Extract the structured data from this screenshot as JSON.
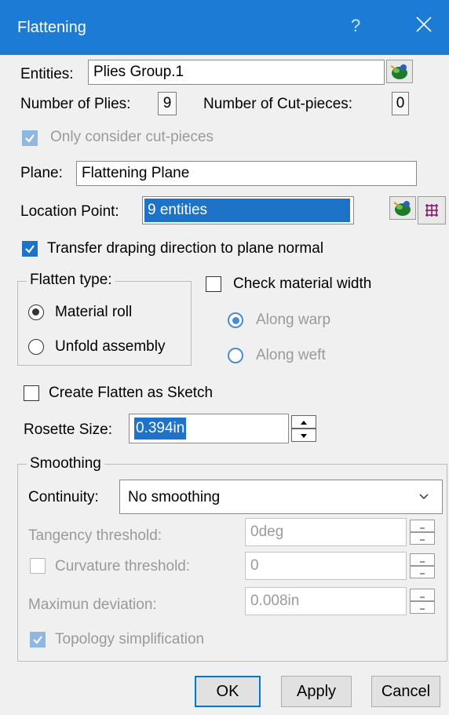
{
  "dialog": {
    "title": "Flattening",
    "help_glyph": "?"
  },
  "entities": {
    "label": "Entities:",
    "value": "Plies Group.1"
  },
  "counts": {
    "plies_label": "Number of Plies:",
    "plies_value": "9",
    "cut_label": "Number of Cut-pieces:",
    "cut_value": "0"
  },
  "only_cut": {
    "label": "Only consider cut-pieces",
    "checked": true,
    "enabled": false
  },
  "plane": {
    "label": "Plane:",
    "value": "Flattening Plane"
  },
  "location": {
    "label": "Location Point:",
    "value": "9 entities",
    "highlight": "#1e73c8"
  },
  "transfer": {
    "label": "Transfer draping direction to plane normal",
    "checked": true
  },
  "flatten_type": {
    "legend": "Flatten type:",
    "options": [
      "Material roll",
      "Unfold assembly"
    ],
    "selected": "Material roll"
  },
  "check_width": {
    "label": "Check material width",
    "checked": false,
    "options": [
      "Along warp",
      "Along weft"
    ],
    "selected": "Along warp"
  },
  "sketch": {
    "label": "Create Flatten as Sketch",
    "checked": false
  },
  "rosette": {
    "label": "Rosette Size:",
    "value": "0.394in"
  },
  "smoothing": {
    "legend": "Smoothing",
    "continuity_label": "Continuity:",
    "continuity_value": "No smoothing",
    "tangency_label": "Tangency threshold:",
    "tangency_value": "0deg",
    "curvature_label": "Curvature threshold:",
    "curvature_value": "0",
    "deviation_label": "Maximun deviation:",
    "deviation_value": "0.008in",
    "topology_label": "Topology simplification"
  },
  "buttons": {
    "ok": "OK",
    "apply": "Apply",
    "cancel": "Cancel"
  },
  "colors": {
    "titlebar": "#1c7cd5",
    "accent": "#1e73c8",
    "disabled": "#9a9a9a"
  },
  "icons": [
    "close-icon",
    "help-icon",
    "select-entity-icon",
    "grid-points-icon",
    "chevron-down-icon"
  ]
}
